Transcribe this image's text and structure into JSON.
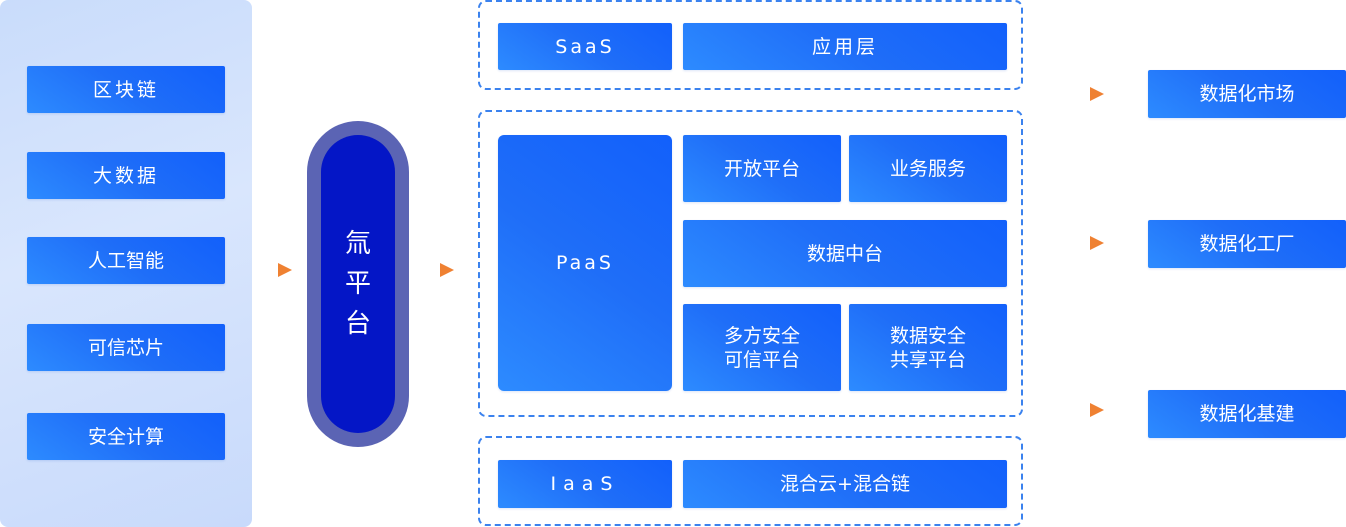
{
  "left": {
    "items": [
      {
        "label": "区块链"
      },
      {
        "label": "大数据"
      },
      {
        "label": "人工智能"
      },
      {
        "label": "可信芯片"
      },
      {
        "label": "安全计算"
      }
    ]
  },
  "center_platform": {
    "chars": [
      "氚",
      "平",
      "台"
    ]
  },
  "layers": {
    "saas": {
      "label": "SaaS",
      "content": "应用层"
    },
    "paas": {
      "label": "PaaS",
      "open_platform": "开放平台",
      "business_service": "业务服务",
      "data_middle": "数据中台",
      "mpc": {
        "line1": "多方安全",
        "line2": "可信平台"
      },
      "data_share": {
        "line1": "数据安全",
        "line2": "共享平台"
      }
    },
    "iaas": {
      "label": "IaaS",
      "content": "混合云+混合链"
    }
  },
  "outputs": {
    "items": [
      {
        "label": "数据化市场"
      },
      {
        "label": "数据化工厂"
      },
      {
        "label": "数据化基建"
      }
    ]
  },
  "colors": {
    "block_blue": "#1f6ef8",
    "platform_dark": "#0416c6",
    "platform_ring": "#5b64b4",
    "arrow_orange": "#ef8132",
    "dash_border": "#3b82ee",
    "panel_bg": "#d3e2fc"
  }
}
